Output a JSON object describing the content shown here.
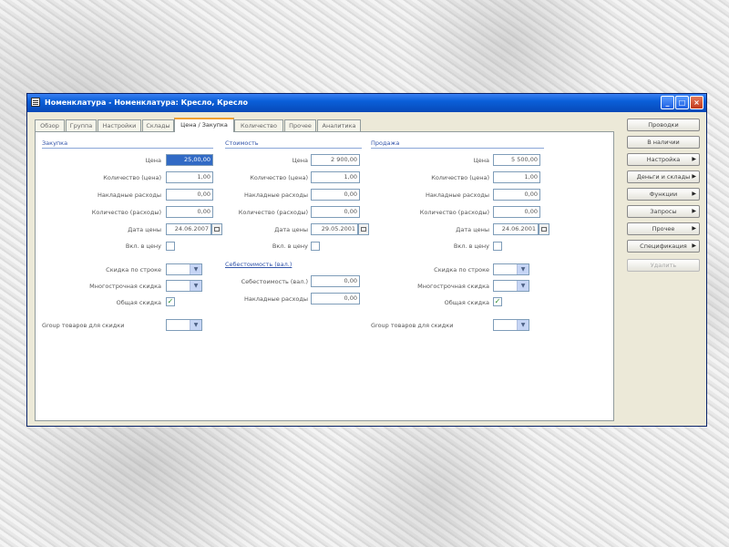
{
  "window": {
    "title": "Номенклатура - Номенклатура: Кресло, Кресло",
    "minimize": "_",
    "maximize": "□",
    "close": "×"
  },
  "tabs": [
    "Обзор",
    "Группа",
    "Настройки",
    "Склады",
    "Цена / Закупка",
    "Количество",
    "Прочее",
    "Аналитика"
  ],
  "active_tab": "Цена / Закупка",
  "columns": [
    {
      "section": "Закупка",
      "price_label": "Цена",
      "price_value": "25,00,00",
      "qty_label": "Количество (цена)",
      "qty_value": "1,00",
      "overhead_label": "Накладные расходы",
      "overhead_value": "0,00",
      "qtyexp_label": "Количество (расходы)",
      "qtyexp_value": "0,00",
      "date_label": "Дата цены",
      "date_value": "24.06.2007",
      "incl_label": "Вкл. в цену"
    },
    {
      "section": "Стоимость",
      "price_label": "Цена",
      "price_value": "2 900,00",
      "qty_label": "Количество (цена)",
      "qty_value": "1,00",
      "overhead_label": "Накладные расходы",
      "overhead_value": "0,00",
      "qtyexp_label": "Количество (расходы)",
      "qtyexp_value": "0,00",
      "date_label": "Дата цены",
      "date_value": "29.05.2001",
      "incl_label": "Вкл. в цену"
    },
    {
      "section": "Продажа",
      "price_label": "Цена",
      "price_value": "5 500,00",
      "qty_label": "Количество (цена)",
      "qty_value": "1,00",
      "overhead_label": "Накладные расходы",
      "overhead_value": "0,00",
      "qtyexp_label": "Количество (расходы)",
      "qtyexp_value": "0,00",
      "date_label": "Дата цены",
      "date_value": "24.06.2001",
      "incl_label": "Вкл. в цену"
    }
  ],
  "discounts": {
    "group_label": "Скидка по строке",
    "multiline_label": "Многострочная скидка",
    "total_label": "Общая скидка",
    "item_group_label": "Group товаров для скидки"
  },
  "discounts_sales": {
    "group_label": "Скидка по строке",
    "multiline_label": "Многострочная скидка",
    "total_label": "Общая скидка",
    "item_group_label": "Group товаров для скидки"
  },
  "cost": {
    "section": "Себестоимость (вал.)",
    "cost_label": "Себестоимость (вал.)",
    "cost_value": "0,00",
    "overhead_label": "Накладные расходы",
    "overhead_value": "0,00"
  },
  "right_buttons": [
    {
      "label": "Проводки",
      "menu": false,
      "enabled": true
    },
    {
      "label": "В наличии",
      "menu": false,
      "enabled": true
    },
    {
      "label": "Настройка",
      "menu": true,
      "enabled": true
    },
    {
      "label": "Деньги и склады",
      "menu": true,
      "enabled": true
    },
    {
      "label": "Функции",
      "menu": true,
      "enabled": true
    },
    {
      "label": "Запросы",
      "menu": true,
      "enabled": true
    },
    {
      "label": "Прочее",
      "menu": true,
      "enabled": true
    },
    {
      "label": "Спецификация",
      "menu": true,
      "enabled": true
    },
    {
      "label": "Удалить",
      "menu": false,
      "enabled": false
    }
  ],
  "icons": {
    "menu_arrow": "triangle-right-icon",
    "dropdown": "chevron-down-icon",
    "check": "checkbox-checked-icon",
    "calendar": "calendar-icon",
    "app": "form-icon"
  },
  "colors": {
    "titlebar": "#0a5fd8",
    "selection": "#316ac5",
    "active_tab_accent": "#f0a030",
    "section_text": "#3355aa"
  }
}
